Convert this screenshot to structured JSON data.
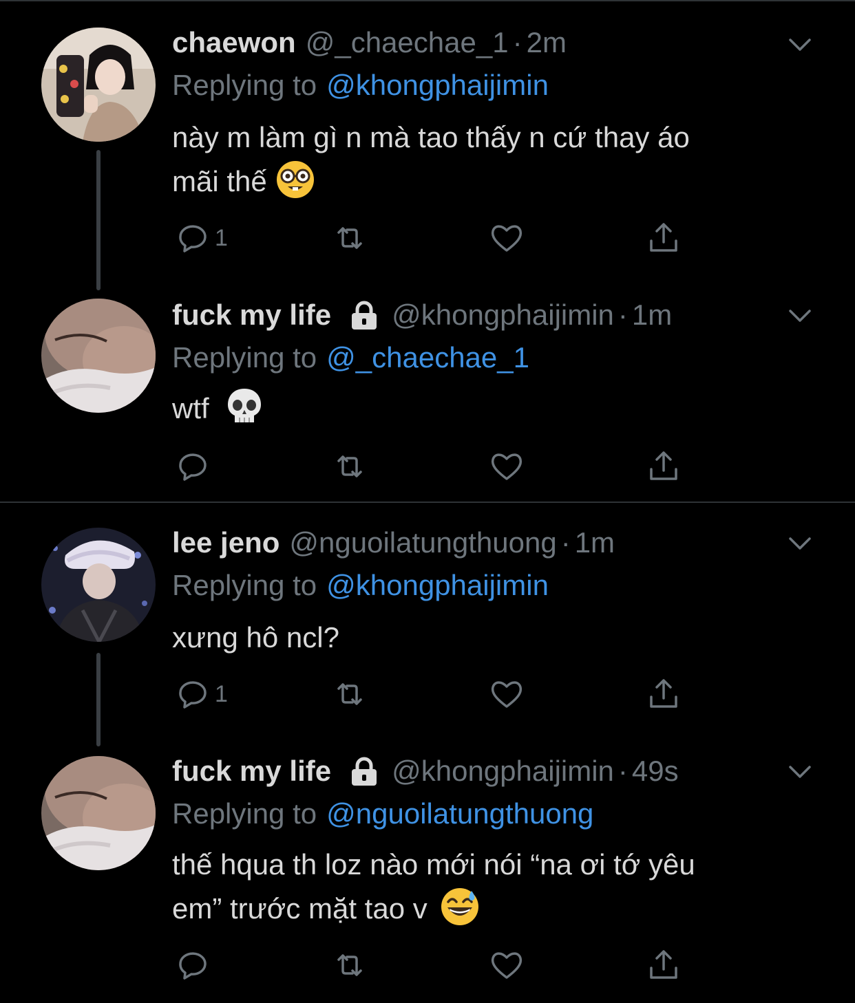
{
  "threads": [
    {
      "tweets": [
        {
          "display_name": "chaewon",
          "locked": false,
          "handle": "@_chaechae_1",
          "separator": "·",
          "time": "2m",
          "reply_prefix": "Replying to",
          "reply_to": "@khongphaijimin",
          "text_lines": [
            "này m làm gì n mà tao thấy n cứ thay áo",
            "mãi thế"
          ],
          "emoji": "nerd-face-emoji",
          "reply_count": "1",
          "avatar": "selfie-photo"
        },
        {
          "display_name": "fuck my life",
          "locked": true,
          "handle": "@khongphaijimin",
          "separator": "·",
          "time": "1m",
          "reply_prefix": "Replying to",
          "reply_to": "@_chaechae_1",
          "text_lines": [
            "wtf"
          ],
          "emoji": "skull-emoji",
          "reply_count": "",
          "avatar": "sleeping-face-photo"
        }
      ]
    },
    {
      "tweets": [
        {
          "display_name": "lee jeno",
          "locked": false,
          "handle": "@nguoilatungthuong",
          "separator": "·",
          "time": "1m",
          "reply_prefix": "Replying to",
          "reply_to": "@khongphaijimin",
          "text_lines": [
            "xưng hô ncl?"
          ],
          "emoji": "",
          "reply_count": "1",
          "avatar": "fur-hat-photo"
        },
        {
          "display_name": "fuck my life",
          "locked": true,
          "handle": "@khongphaijimin",
          "separator": "·",
          "time": "49s",
          "reply_prefix": "Replying to",
          "reply_to": "@nguoilatungthuong",
          "text_lines": [
            "thế hqua th loz nào mới nói “na ơi tớ yêu",
            "em” trước mặt tao v"
          ],
          "emoji": "grinning-sweat-emoji",
          "reply_count": "",
          "avatar": "sleeping-face-photo"
        }
      ]
    }
  ],
  "colors": {
    "background": "#000000",
    "text": "#D9D9D9",
    "muted": "#6E767D",
    "link": "#3F92E4",
    "divider": "#2F3336"
  }
}
